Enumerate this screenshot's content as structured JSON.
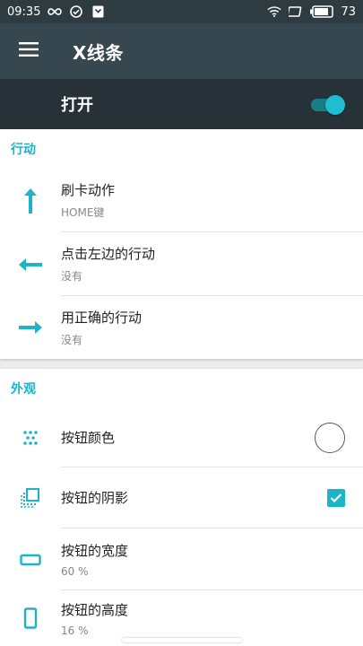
{
  "status_bar": {
    "time": "09:35",
    "battery": "73"
  },
  "toolbar": {
    "title": "X线条"
  },
  "master_switch": {
    "label": "打开",
    "enabled": true
  },
  "sections": {
    "actions": {
      "header": "行动",
      "items": [
        {
          "title": "刷卡动作",
          "subtitle": "HOME键",
          "icon": "arrow-up-icon"
        },
        {
          "title": "点击左边的行动",
          "subtitle": "没有",
          "icon": "arrow-left-icon"
        },
        {
          "title": "用正确的行动",
          "subtitle": "没有",
          "icon": "arrow-right-icon"
        }
      ]
    },
    "appearance": {
      "header": "外观",
      "items": [
        {
          "title": "按钮颜色",
          "icon": "dots-palette-icon",
          "control": "color-circle"
        },
        {
          "title": "按钮的阴影",
          "icon": "shadow-layers-icon",
          "control": "checkbox",
          "checked": true
        },
        {
          "title": "按钮的宽度",
          "subtitle": "60 %",
          "icon": "width-rect-icon"
        },
        {
          "title": "按钮的高度",
          "subtitle": "16 %",
          "icon": "height-rect-icon"
        }
      ]
    }
  },
  "colors": {
    "accent": "#1bb4c8",
    "toolbar": "#37474f",
    "switchbar": "#263238",
    "statusbar": "#2e3b40"
  }
}
